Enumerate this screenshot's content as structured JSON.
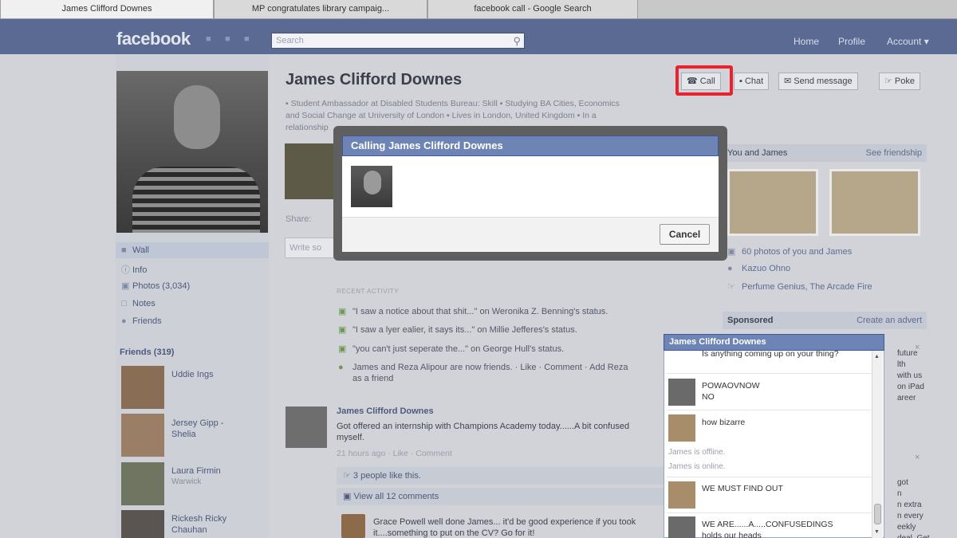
{
  "browser": {
    "tabs": [
      {
        "label": "James Clifford Downes"
      },
      {
        "label": "MP congratulates library campaig..."
      },
      {
        "label": "facebook call - Google Search"
      }
    ]
  },
  "topbar": {
    "logo": "facebook",
    "search_placeholder": "Search",
    "nav": [
      "Home",
      "Profile",
      "Account ▾"
    ]
  },
  "profile": {
    "name": "James Clifford Downes",
    "info_lines": [
      "▪ Student Ambassador at Disabled Students Bureau: Skill  ▪ Studying BA Cities, Economics",
      "and Social Change at University of London  ▪ Lives in London, United Kingdom  ▪ In a",
      "relationship"
    ],
    "actions": {
      "call": "Call",
      "chat": "Chat",
      "message": "Send message",
      "poke": "Poke"
    },
    "left_nav": [
      {
        "label": "Wall",
        "icon": "wall-icon"
      },
      {
        "label": "Info",
        "icon": "info-icon"
      },
      {
        "label": "Photos (3,034)",
        "icon": "photos-icon"
      },
      {
        "label": "Notes",
        "icon": "notes-icon"
      },
      {
        "label": "Friends",
        "icon": "friends-icon"
      }
    ],
    "friends_heading": "Friends (319)",
    "friends": [
      {
        "name": "Uddie Ings",
        "sub": ""
      },
      {
        "name": "Jersey Gipp - Shelia",
        "sub": ""
      },
      {
        "name": "Laura Firmin",
        "sub": "Warwick"
      },
      {
        "name": "Rickesh Ricky Chauhan",
        "sub": ""
      }
    ]
  },
  "share": {
    "label": "Share:",
    "placeholder": "Write so"
  },
  "recent": {
    "heading": "RECENT ACTIVITY",
    "items": [
      {
        "text": "\"I saw a notice about that shit...\" on Weronika Z. Benning's status."
      },
      {
        "text": "\"I saw a lyer ealier, it says its...\" on Millie Jefferes's status."
      },
      {
        "text": "\"you can't just seperate the...\" on George Hull's status."
      },
      {
        "text": "James and Reza Alipour are now friends. · Like · Comment · Add Reza"
      },
      {
        "text": "as a friend"
      }
    ]
  },
  "post": {
    "author": "James Clifford Downes",
    "text": "Got offered an internship with Champions Academy today......A bit confused myself.",
    "meta": "21 hours ago · Like · Comment",
    "likes": "3 people like this.",
    "view_all": "View all 12 comments",
    "comment": "Grace Powell well done James... it'd be good experience if you took it....something to put on the CV? Go for it!"
  },
  "right": {
    "friendship_heading": "You and James",
    "friendship_link": "See friendship",
    "lines": [
      "60 photos of you and James",
      "Kazuo Ohno",
      "Perfume Genius, The Arcade Fire"
    ],
    "sponsored": "Sponsored",
    "create_ad": "Create an advert",
    "ad_text_1": "future\nlth\nwith us\non iPad\nareer",
    "ad_text_2": "got\nn\nn extra\nn every\neekly\ndeal. Get"
  },
  "modal": {
    "title": "Calling James Clifford Downes",
    "cancel": "Cancel"
  },
  "chat": {
    "title": "James Clifford Downes",
    "messages": [
      {
        "text": "Is anything coming up on your thing?"
      },
      {
        "text": "POWAOVNOW\nNO"
      },
      {
        "text": "how bizarre"
      },
      {
        "text": "James is offline."
      },
      {
        "text": "James is online."
      },
      {
        "text": "WE MUST FIND OUT"
      },
      {
        "text": "WE ARE......A.....CONFUSEDINGS\nholds our heads"
      }
    ]
  },
  "colors": {
    "fb_blue": "#6d84b4",
    "highlight_red": "#e8232e"
  }
}
